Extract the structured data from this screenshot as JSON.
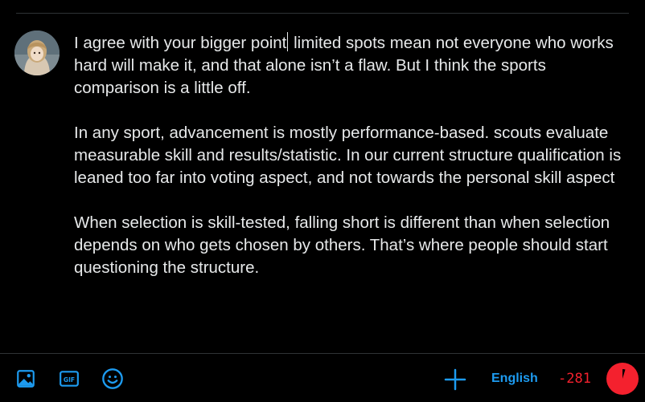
{
  "post": {
    "paragraphs": [
      {
        "before_caret": "I agree with your bigger point",
        "after_caret": " limited spots mean not everyone who works hard will make it, and that alone isn’t a flaw. But I think the sports comparison is a little off."
      },
      {
        "before_caret": "In any sport, advancement is mostly performance-based. scouts evaluate measurable skill and results/statistic. In our current structure qualification is leaned too far into voting aspect, and not towards the personal skill aspect",
        "after_caret": ""
      },
      {
        "before_caret": "When selection is skill-tested, falling short is different than when selection depends on who gets chosen by others. That’s where people should start questioning the structure.",
        "after_caret": ""
      }
    ]
  },
  "toolbar": {
    "icons": [
      "image-icon",
      "gif-icon",
      "emoji-icon",
      "plus-icon"
    ],
    "language_label": "English",
    "char_count": "-281",
    "char_limit_exceeded": true
  },
  "colors": {
    "accent": "#1d9bf0",
    "over_limit": "#f4212e",
    "text": "#e7e9ea",
    "divider": "#2f3336",
    "background": "#000000"
  }
}
